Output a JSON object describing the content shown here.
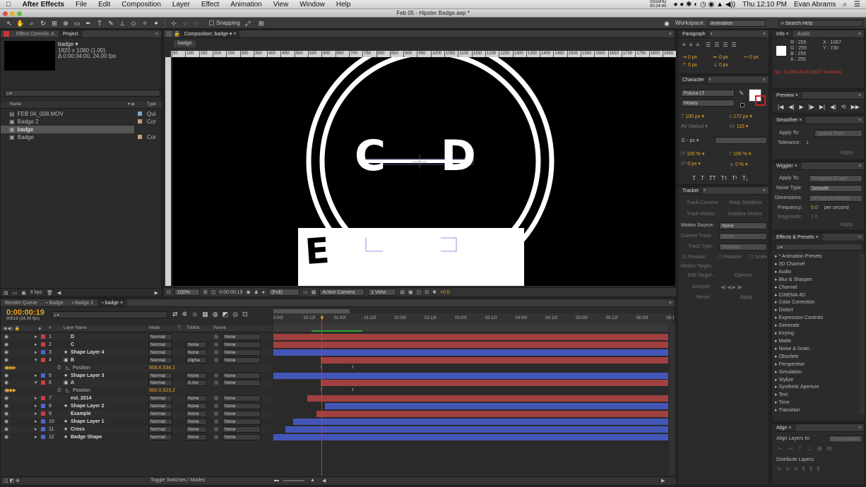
{
  "menubar": {
    "app": "After Effects",
    "items": [
      "File",
      "Edit",
      "Composition",
      "Layer",
      "Effect",
      "Animation",
      "View",
      "Window",
      "Help"
    ],
    "clock": "Thu 12:10 PM",
    "user": "Evan Abrams",
    "show_hd": "ShowHD",
    "show_time": "00:24:40"
  },
  "window_title": "Feb 05 - Hipster Badge.aep *",
  "toolbar": {
    "snapping": "Snapping",
    "workspace_label": "Workspace:",
    "workspace": "Animation",
    "search_help": "Search Help"
  },
  "project_panel": {
    "tab_effect_controls": "Effect Controls: A",
    "tab_project": "Project",
    "item_name": "badge ▾",
    "item_dims": "1920 x 1080 (1.00)",
    "item_duration": "Δ 0:00:34:00, 24.00 fps",
    "col_name": "Name",
    "col_type": "Type",
    "items": [
      {
        "name": "FEB 04_008.MOV",
        "type": "Qui",
        "color": "#7ac"
      },
      {
        "name": "Badge 2",
        "type": "Cor",
        "color": "#c8a070"
      },
      {
        "name": "badge",
        "type": "Cor",
        "color": "#c8a070"
      },
      {
        "name": "Badge",
        "type": "Cor",
        "color": "#c8a070"
      }
    ],
    "bpc": "8 bpc"
  },
  "comp_panel": {
    "tab": "Composition: badge",
    "subtab": "badge",
    "ruler": [
      "50",
      "100",
      "150",
      "200",
      "250",
      "300",
      "350",
      "400",
      "450",
      "500",
      "550",
      "600",
      "650",
      "700",
      "750",
      "800",
      "850",
      "900",
      "950",
      "1000",
      "1050",
      "1100",
      "1150",
      "1200",
      "1250",
      "1300",
      "1350",
      "1400",
      "1450",
      "1500",
      "1550",
      "1600",
      "1650",
      "1700",
      "1750",
      "1800",
      "1850",
      "190"
    ],
    "badge_letter_left": "C",
    "badge_letter_right": "D",
    "badge_letter_bottom": "E",
    "zoom": "100%",
    "timecode": "0:00:00:19",
    "resolution": "(Full)",
    "camera": "Active Camera",
    "view": "1 View",
    "exposure": "+0.0"
  },
  "timeline": {
    "tabs": [
      "Render Queue",
      "Badge",
      "Badge 2",
      "badge"
    ],
    "timecode": "0:00:00:19",
    "frames": "00019 (24.00 fps)",
    "ruler": [
      "0:00f",
      "00:12f",
      "01:00f",
      "01:12f",
      "02:00f",
      "02:12f",
      "03:00f",
      "03:12f",
      "04:00f",
      "04:12f",
      "05:00f",
      "05:12f",
      "06:00f",
      "06:1"
    ],
    "headers": {
      "layer_name": "Layer Name",
      "mode": "Mode",
      "t": "T",
      "trkmat": "TrkMat",
      "parent": "Parent"
    },
    "layers": [
      {
        "num": "1",
        "name": "D",
        "color": "#c84040",
        "mode": "Normal",
        "trk": "",
        "parent": "None",
        "bar_color": "#a04040",
        "start": 0.0,
        "end": 1.0
      },
      {
        "num": "2",
        "name": "C",
        "color": "#c84040",
        "mode": "Normal",
        "trk": "None",
        "parent": "None",
        "bar_color": "#a04040",
        "start": 0.0,
        "end": 1.0
      },
      {
        "num": "3",
        "name": "Shape Layer 4",
        "color": "#4a6acc",
        "mode": "Normal",
        "trk": "None",
        "parent": "None",
        "bar_color": "#4356b8",
        "start": 0.0,
        "end": 1.0
      },
      {
        "num": "4",
        "name": "B",
        "color": "#c84040",
        "mode": "Normal",
        "trk": "Alpha",
        "parent": "None",
        "bar_color": "#a04040",
        "start": 0.12,
        "end": 1.0
      },
      {
        "num": "",
        "name": "Position",
        "color": "",
        "mode": "958.6,534.2",
        "trk": "",
        "parent": "",
        "bar_color": "",
        "start": 0,
        "end": 0
      },
      {
        "num": "5",
        "name": "Shape Layer 3",
        "color": "#4a6acc",
        "mode": "Normal",
        "trk": "None",
        "parent": "None",
        "bar_color": "#4356b8",
        "start": 0.0,
        "end": 1.0
      },
      {
        "num": "6",
        "name": "A",
        "color": "#c84040",
        "mode": "Normal",
        "trk": "A.Inv",
        "parent": "None",
        "bar_color": "#a04040",
        "start": 0.12,
        "end": 1.0
      },
      {
        "num": "",
        "name": "Position",
        "color": "",
        "mode": "960.0,623.2",
        "trk": "",
        "parent": "",
        "bar_color": "",
        "start": 0,
        "end": 0
      },
      {
        "num": "7",
        "name": "est. 2014",
        "color": "#c84040",
        "mode": "Normal",
        "trk": "None",
        "parent": "None",
        "bar_color": "#a04040",
        "start": 0.085,
        "end": 1.0
      },
      {
        "num": "8",
        "name": "Shape Layer 2",
        "color": "#4a6acc",
        "mode": "Normal",
        "trk": "None",
        "parent": "None",
        "bar_color": "#4356b8",
        "start": 0.13,
        "end": 1.0
      },
      {
        "num": "9",
        "name": "Example",
        "color": "#c84040",
        "mode": "Normal",
        "trk": "None",
        "parent": "None",
        "bar_color": "#a04040",
        "start": 0.11,
        "end": 1.0
      },
      {
        "num": "10",
        "name": "Shape Layer 1",
        "color": "#4a6acc",
        "mode": "Normal",
        "trk": "None",
        "parent": "None",
        "bar_color": "#4356b8",
        "start": 0.05,
        "end": 1.0
      },
      {
        "num": "11",
        "name": "Cross",
        "color": "#4a6acc",
        "mode": "Normal",
        "trk": "None",
        "parent": "None",
        "bar_color": "#4356b8",
        "start": 0.03,
        "end": 1.0
      },
      {
        "num": "12",
        "name": "Badge Shape",
        "color": "#4a6acc",
        "mode": "Normal",
        "trk": "None",
        "parent": "None",
        "bar_color": "#4356b8",
        "start": 0.0,
        "end": 1.0
      }
    ],
    "toggle": "Toggle Switches / Modes"
  },
  "paragraph": {
    "title": "Paragraph",
    "indent_left": "0 px",
    "indent_right": "0 px",
    "indent_first": "0 px",
    "space_before": "0 px",
    "space_after": "0 px"
  },
  "character": {
    "title": "Character",
    "font": "Futura LT",
    "style": "Heavy",
    "size": "100 px",
    "leading": "172 px",
    "kerning": "Optical",
    "tracking": "116",
    "stroke": "- px",
    "vscale": "100 %",
    "hscale": "100 %",
    "baseline": "0 px",
    "tsume": "0 %"
  },
  "tracker": {
    "title": "Tracker",
    "track_camera": "Track Camera",
    "warp": "Warp Stabilizer",
    "track_motion": "Track Motion",
    "stabilize": "Stabilize Motion",
    "motion_source_label": "Motion Source:",
    "motion_source": "None",
    "current_track_label": "Current Track:",
    "current_track": "None",
    "track_type_label": "Track Type:",
    "track_type": "Stabilize",
    "position": "Position",
    "rotation": "Rotation",
    "scale": "Scale",
    "motion_target": "Motion Target:",
    "edit_target": "Edit Target...",
    "options": "Options...",
    "analyze": "Analyze:",
    "reset": "Reset",
    "apply": "Apply"
  },
  "info": {
    "tab_info": "Info",
    "tab_audio": "Audio",
    "r": "R : 255",
    "g": "G : 255",
    "b": "B : 255",
    "a": "A : 255",
    "x": "X : 1067",
    "y": "Y : 730",
    "fps": "fps: 11.995/24.00 (NOT realtime)"
  },
  "preview": {
    "title": "Preview"
  },
  "smoother": {
    "title": "Smoother",
    "apply_to_label": "Apply To:",
    "apply_to": "Spatial Path",
    "tolerance_label": "Tolerance:",
    "tolerance": "1",
    "apply": "Apply"
  },
  "wiggler": {
    "title": "Wiggler",
    "apply_to_label": "Apply To:",
    "apply_to": "Temporal Graph",
    "noise_label": "Noise Type:",
    "noise": "Smooth",
    "dimensions_label": "Dimensions:",
    "dimensions": "All Independently",
    "frequency_label": "Frequency:",
    "frequency": "5.0",
    "freq_unit": "per second",
    "magnitude_label": "Magnitude:",
    "magnitude": "1.0",
    "apply": "Apply"
  },
  "effects": {
    "title": "Effects & Presets",
    "items": [
      "* Animation Presets",
      "3D Channel",
      "Audio",
      "Blur & Sharpen",
      "Channel",
      "CINEMA 4D",
      "Color Correction",
      "Distort",
      "Expression Controls",
      "Generate",
      "Keying",
      "Matte",
      "Noise & Grain",
      "Obsolete",
      "Perspective",
      "Simulation",
      "Stylize",
      "Synthetic Aperture",
      "Text",
      "Time",
      "Transition"
    ]
  },
  "align": {
    "title": "Align",
    "align_to_label": "Align Layers to:",
    "align_to": "Composition",
    "distribute": "Distribute Layers:"
  }
}
